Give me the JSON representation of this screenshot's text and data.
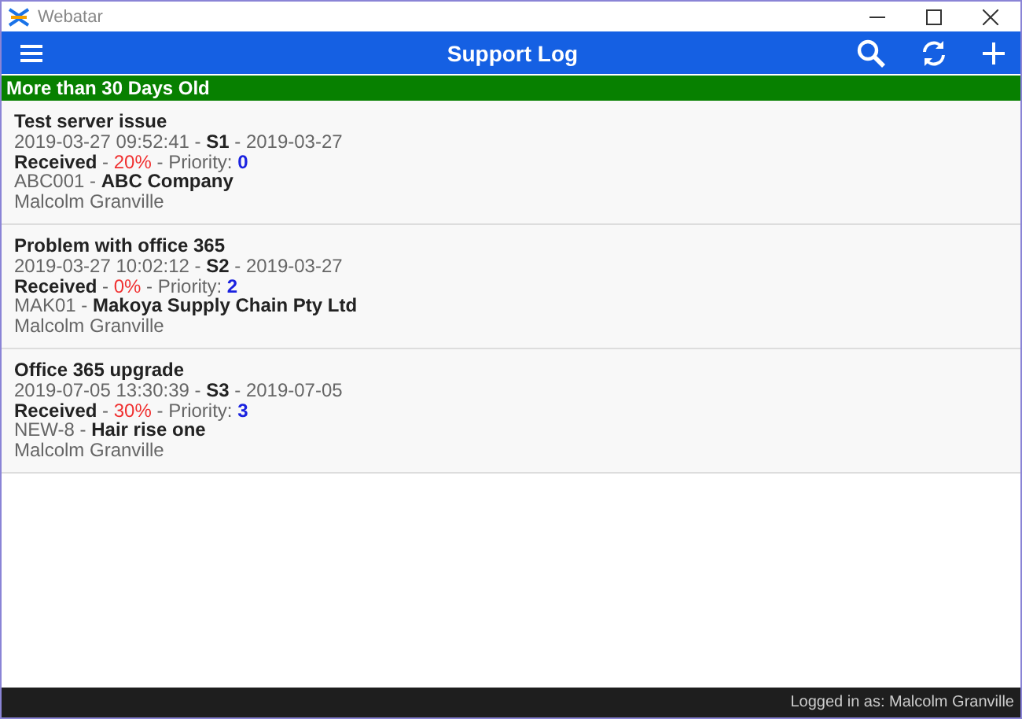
{
  "window": {
    "title": "Webatar"
  },
  "toolbar": {
    "title": "Support Log"
  },
  "section": {
    "heading": "More than 30 Days Old"
  },
  "tickets": [
    {
      "title": "Test server issue",
      "lines": [
        [
          {
            "text": "2019-03-27 09:52:41 - ",
            "kind": "plain"
          },
          {
            "text": "S1",
            "kind": "bold"
          },
          {
            "text": " - 2019-03-27",
            "kind": "plain"
          }
        ],
        [
          {
            "text": "Received",
            "kind": "bold"
          },
          {
            "text": " - ",
            "kind": "plain"
          },
          {
            "text": "20%",
            "kind": "alert"
          },
          {
            "text": " - Priority: ",
            "kind": "plain"
          },
          {
            "text": "0",
            "kind": "accent"
          }
        ],
        [
          {
            "text": "ABC001 - ",
            "kind": "plain"
          },
          {
            "text": "ABC Company",
            "kind": "bold"
          }
        ],
        [
          {
            "text": "Malcolm Granville",
            "kind": "plain"
          }
        ]
      ]
    },
    {
      "title": "Problem with office 365",
      "lines": [
        [
          {
            "text": "2019-03-27 10:02:12 - ",
            "kind": "plain"
          },
          {
            "text": "S2",
            "kind": "bold"
          },
          {
            "text": " - 2019-03-27",
            "kind": "plain"
          }
        ],
        [
          {
            "text": "Received",
            "kind": "bold"
          },
          {
            "text": " - ",
            "kind": "plain"
          },
          {
            "text": "0%",
            "kind": "alert"
          },
          {
            "text": " - Priority: ",
            "kind": "plain"
          },
          {
            "text": "2",
            "kind": "accent"
          }
        ],
        [
          {
            "text": "MAK01 - ",
            "kind": "plain"
          },
          {
            "text": "Makoya Supply Chain Pty Ltd",
            "kind": "bold"
          }
        ],
        [
          {
            "text": "Malcolm Granville",
            "kind": "plain"
          }
        ]
      ]
    },
    {
      "title": "Office 365 upgrade",
      "lines": [
        [
          {
            "text": "2019-07-05 13:30:39 - ",
            "kind": "plain"
          },
          {
            "text": "S3",
            "kind": "bold"
          },
          {
            "text": " - 2019-07-05",
            "kind": "plain"
          }
        ],
        [
          {
            "text": "Received",
            "kind": "bold"
          },
          {
            "text": " - ",
            "kind": "plain"
          },
          {
            "text": "30%",
            "kind": "alert"
          },
          {
            "text": " - Priority: ",
            "kind": "plain"
          },
          {
            "text": "3",
            "kind": "accent"
          }
        ],
        [
          {
            "text": "NEW-8 - ",
            "kind": "plain"
          },
          {
            "text": "Hair rise one",
            "kind": "bold"
          }
        ],
        [
          {
            "text": "Malcolm Granville",
            "kind": "plain"
          }
        ]
      ]
    }
  ],
  "status_bar": {
    "text": "Logged in as: Malcolm Granville"
  }
}
